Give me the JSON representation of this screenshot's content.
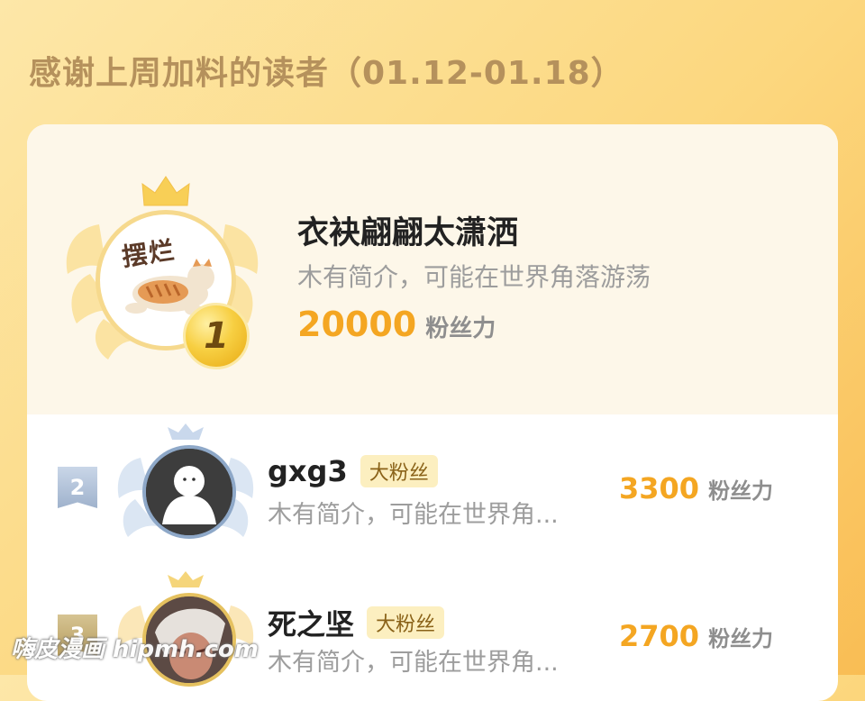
{
  "title": "感谢上周加料的读者（01.12-01.18）",
  "colors": {
    "accent": "#f4a622",
    "background_start": "#fde7a8",
    "background_end": "#f9bd54",
    "title": "#b5915c"
  },
  "top_reader": {
    "rank": "1",
    "avatar_text": "摆烂",
    "name": "衣袂翩翩太潇洒",
    "bio": "木有简介，可能在世界角落游荡",
    "score": "20000",
    "score_unit": "粉丝力",
    "icons": [
      "crown-icon",
      "wings-icon",
      "cat-avatar-icon"
    ]
  },
  "readers": [
    {
      "rank": "2",
      "name": "gxg3",
      "badge": "大粉丝",
      "bio": "木有简介，可能在世界角...",
      "score": "3300",
      "score_unit": "粉丝力"
    },
    {
      "rank": "3",
      "name": "死之坚",
      "badge": "大粉丝",
      "bio": "木有简介，可能在世界角...",
      "score": "2700",
      "score_unit": "粉丝力"
    }
  ],
  "watermark": "嗨皮漫画 hipmh.com"
}
